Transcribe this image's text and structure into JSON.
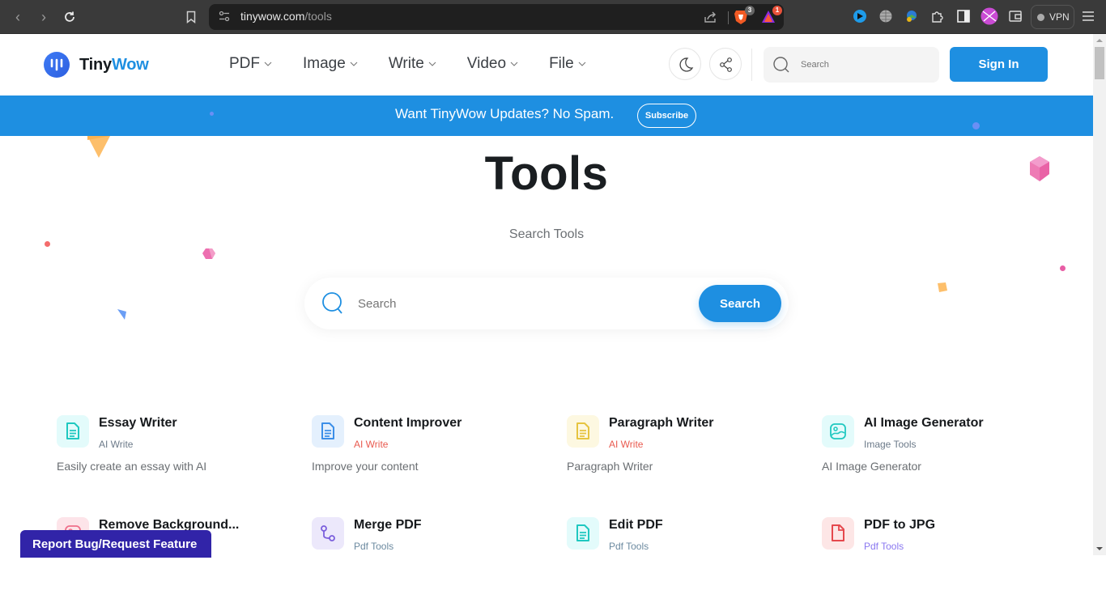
{
  "browser": {
    "url_domain": "tinywow.com",
    "url_path": "/tools",
    "brave_shield_count": "3",
    "rewards_count": "1",
    "vpn_label": "VPN"
  },
  "header": {
    "logo_tiny": "Tiny",
    "logo_wow": "Wow",
    "nav": [
      {
        "label": "PDF"
      },
      {
        "label": "Image"
      },
      {
        "label": "Write"
      },
      {
        "label": "Video"
      },
      {
        "label": "File"
      }
    ],
    "search_placeholder": "Search",
    "sign_in": "Sign In"
  },
  "banner": {
    "message": "Want TinyWow Updates? No Spam.",
    "subscribe": "Subscribe"
  },
  "hero": {
    "title": "Tools",
    "subtitle": "Search Tools",
    "search_placeholder": "Search",
    "search_button": "Search"
  },
  "tools": [
    {
      "name": "Essay Writer",
      "category": "AI Write",
      "description": "Easily create an essay with AI",
      "icon": "document-icon",
      "category_color": "#6c7a89",
      "icon_color": "#1fc8c0",
      "icon_bg": "#e3fbfb"
    },
    {
      "name": "Content Improver",
      "category": "AI Write",
      "description": "Improve your content",
      "icon": "document-icon",
      "category_color": "#e95a4f",
      "icon_color": "#3c8fe8",
      "icon_bg": "#e4f0fd"
    },
    {
      "name": "Paragraph Writer",
      "category": "AI Write",
      "description": "Paragraph Writer",
      "icon": "document-icon",
      "category_color": "#e95a4f",
      "icon_color": "#e6c440",
      "icon_bg": "#fdf8e1"
    },
    {
      "name": "AI Image Generator",
      "category": "Image Tools",
      "description": "AI Image Generator",
      "icon": "image-icon",
      "category_color": "#6c7a89",
      "icon_color": "#1fc8c0",
      "icon_bg": "#e3fbfb"
    },
    {
      "name": "Remove Background...",
      "category": "",
      "description": "",
      "icon": "image-icon",
      "category_color": "#6c7a89",
      "icon_color": "#ef6f8a",
      "icon_bg": "#fde4e9"
    },
    {
      "name": "Merge PDF",
      "category": "Pdf Tools",
      "description": "",
      "icon": "merge-icon",
      "category_color": "#6c8aa0",
      "icon_color": "#7b5fdc",
      "icon_bg": "#ece8fb"
    },
    {
      "name": "Edit PDF",
      "category": "Pdf Tools",
      "description": "",
      "icon": "document-icon",
      "category_color": "#6c8aa0",
      "icon_color": "#1fc8c0",
      "icon_bg": "#e3fbfb"
    },
    {
      "name": "PDF to JPG",
      "category": "Pdf Tools",
      "description": "",
      "icon": "file-icon",
      "category_color": "#8a78f0",
      "icon_color": "#e5484d",
      "icon_bg": "#fde6e6"
    }
  ],
  "report_button": "Report Bug/Request Feature",
  "colors": {
    "brand_blue": "#1e8fe1",
    "report_purple": "#3124a8",
    "title_dark": "#1a1e21"
  }
}
